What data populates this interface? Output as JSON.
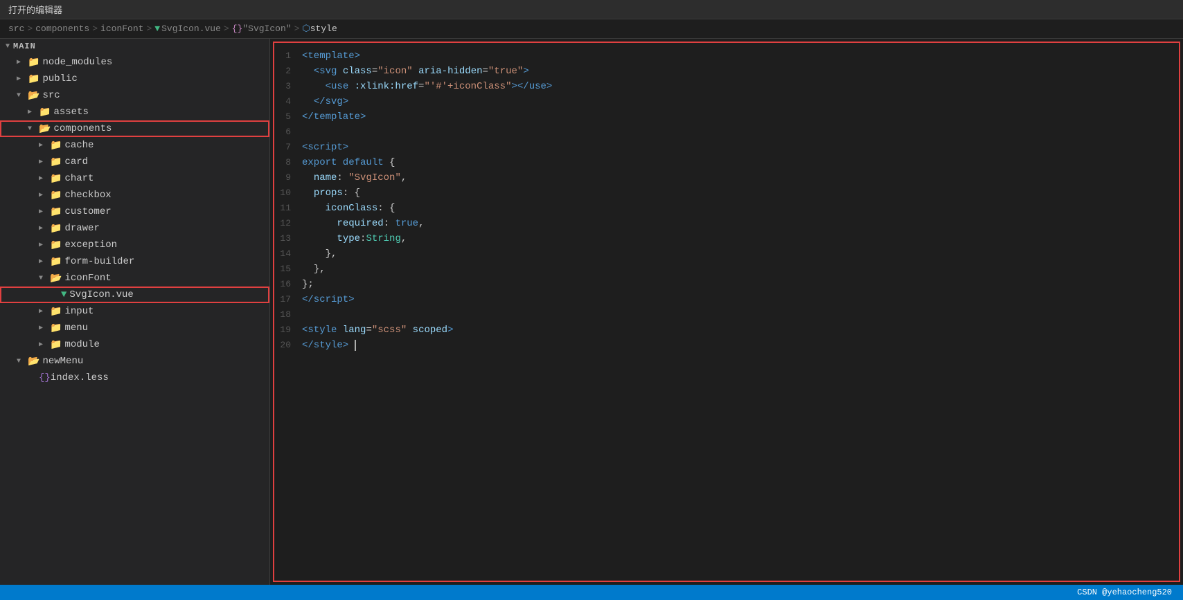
{
  "topbar": {
    "title": "打开的编辑器"
  },
  "breadcrumb": {
    "parts": [
      {
        "text": "src",
        "type": "folder"
      },
      {
        "text": "components",
        "type": "folder"
      },
      {
        "text": "iconFont",
        "type": "folder"
      },
      {
        "text": "SvgIcon.vue",
        "type": "vue"
      },
      {
        "text": "\"SvgIcon\"",
        "type": "curly"
      },
      {
        "text": "style",
        "type": "style"
      }
    ]
  },
  "sidebar": {
    "main_label": "MAIN",
    "items": [
      {
        "id": "node_modules",
        "label": "node_modules",
        "type": "folder",
        "indent": 1,
        "expanded": false
      },
      {
        "id": "public",
        "label": "public",
        "type": "folder",
        "indent": 1,
        "expanded": false
      },
      {
        "id": "src",
        "label": "src",
        "type": "folder",
        "indent": 1,
        "expanded": true
      },
      {
        "id": "assets",
        "label": "assets",
        "type": "folder",
        "indent": 2,
        "expanded": false
      },
      {
        "id": "components",
        "label": "components",
        "type": "folder",
        "indent": 2,
        "expanded": true,
        "highlighted": true
      },
      {
        "id": "cache",
        "label": "cache",
        "type": "folder",
        "indent": 3,
        "expanded": false
      },
      {
        "id": "card",
        "label": "card",
        "type": "folder",
        "indent": 3,
        "expanded": false
      },
      {
        "id": "chart",
        "label": "chart",
        "type": "folder",
        "indent": 3,
        "expanded": false
      },
      {
        "id": "checkbox",
        "label": "checkbox",
        "type": "folder",
        "indent": 3,
        "expanded": false
      },
      {
        "id": "customer",
        "label": "customer",
        "type": "folder",
        "indent": 3,
        "expanded": false
      },
      {
        "id": "drawer",
        "label": "drawer",
        "type": "folder",
        "indent": 3,
        "expanded": false
      },
      {
        "id": "exception",
        "label": "exception",
        "type": "folder",
        "indent": 3,
        "expanded": false
      },
      {
        "id": "form-builder",
        "label": "form-builder",
        "type": "folder",
        "indent": 3,
        "expanded": false
      },
      {
        "id": "iconFont",
        "label": "iconFont",
        "type": "folder",
        "indent": 3,
        "expanded": true
      },
      {
        "id": "SvgIcon.vue",
        "label": "SvgIcon.vue",
        "type": "vue",
        "indent": 4,
        "highlighted": true
      },
      {
        "id": "input",
        "label": "input",
        "type": "folder",
        "indent": 3,
        "expanded": false
      },
      {
        "id": "menu",
        "label": "menu",
        "type": "folder",
        "indent": 3,
        "expanded": false
      },
      {
        "id": "module",
        "label": "module",
        "type": "folder",
        "indent": 3,
        "expanded": false
      },
      {
        "id": "newMenu",
        "label": "newMenu",
        "type": "folder",
        "indent": 1,
        "expanded": true
      },
      {
        "id": "index.less",
        "label": "index.less",
        "type": "less",
        "indent": 2,
        "expanded": false
      }
    ]
  },
  "code": {
    "lines": [
      {
        "num": 1,
        "html": "<span class='c-tag'>&lt;template&gt;</span>"
      },
      {
        "num": 2,
        "html": "  <span class='c-tag'>&lt;svg</span> <span class='c-attr-name'>class</span>=<span class='c-attr-value'>\"icon\"</span> <span class='c-attr-name'>aria-hidden</span>=<span class='c-attr-value'>\"true\"</span><span class='c-tag'>&gt;</span>"
      },
      {
        "num": 3,
        "html": "    <span class='c-tag'>&lt;use</span> <span class='c-attr-name'>:xlink:href</span>=<span class='c-attr-value'>\"'#'+iconClass\"</span><span class='c-tag'>&gt;&lt;/use&gt;</span>"
      },
      {
        "num": 4,
        "html": "  <span class='c-tag'>&lt;/svg&gt;</span>"
      },
      {
        "num": 5,
        "html": "<span class='c-tag'>&lt;/template&gt;</span>"
      },
      {
        "num": 6,
        "html": ""
      },
      {
        "num": 7,
        "html": "<span class='c-tag'>&lt;script&gt;</span>"
      },
      {
        "num": 8,
        "html": "<span class='c-keyword'>export default</span> <span class='c-punctuation'>{</span>"
      },
      {
        "num": 9,
        "html": "  <span class='c-property'>name</span><span class='c-punctuation'>:</span> <span class='c-string'>\"SvgIcon\"</span><span class='c-punctuation'>,</span>"
      },
      {
        "num": 10,
        "html": "  <span class='c-property'>props</span><span class='c-punctuation'>:</span> <span class='c-punctuation'>{</span>"
      },
      {
        "num": 11,
        "html": "    <span class='c-property'>iconClass</span><span class='c-punctuation'>:</span> <span class='c-punctuation'>{</span>"
      },
      {
        "num": 12,
        "html": "      <span class='c-property'>required</span><span class='c-punctuation'>:</span> <span class='c-keyword'>true</span><span class='c-punctuation'>,</span>"
      },
      {
        "num": 13,
        "html": "      <span class='c-property'>type</span><span class='c-punctuation'>:</span><span class='c-teal'>String</span><span class='c-punctuation'>,</span>"
      },
      {
        "num": 14,
        "html": "    <span class='c-punctuation'>},</span>"
      },
      {
        "num": 15,
        "html": "  <span class='c-punctuation'>},</span>"
      },
      {
        "num": 16,
        "html": "<span class='c-punctuation'>};</span>"
      },
      {
        "num": 17,
        "html": "<span class='c-tag'>&lt;/script&gt;</span>"
      },
      {
        "num": 18,
        "html": ""
      },
      {
        "num": 19,
        "html": "<span class='c-tag'>&lt;style</span> <span class='c-attr-name'>lang</span>=<span class='c-attr-value'>\"scss\"</span> <span class='c-attr-name'>scoped</span><span class='c-tag'>&gt;</span>"
      },
      {
        "num": 20,
        "html": "<span class='c-tag'>&lt;/style&gt;</span><span class='c-cursor'> </span>"
      }
    ]
  },
  "statusbar": {
    "text": "CSDN @yehaocheng520"
  }
}
